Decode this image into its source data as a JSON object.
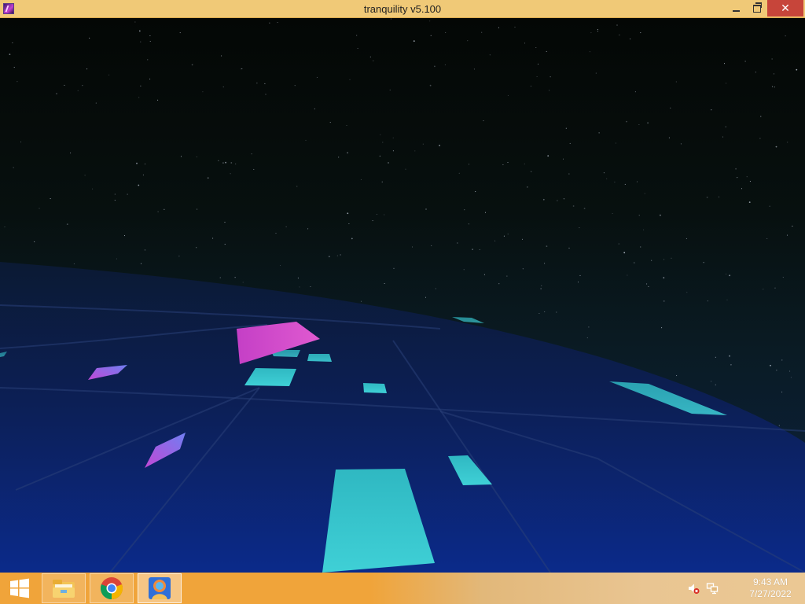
{
  "window": {
    "title": "tranquility v5.100",
    "close_glyph": "✕"
  },
  "icons": {
    "app": "tranquility-app-icon",
    "minimize": "minimize-icon",
    "restore": "restore-icon",
    "close": "close-icon",
    "start": "windows-logo-icon",
    "explorer": "file-explorer-icon",
    "chrome": "chrome-icon",
    "tranquility": "tranquility-icon",
    "volume": "volume-muted-icon",
    "network": "network-icon"
  },
  "scene": {
    "sky_colors": [
      "#050806",
      "#0a1a1c",
      "#0b1f3a"
    ],
    "floor_colors": [
      "#0a1d3f",
      "#0a2b80"
    ],
    "tile_cyan": "#39c6cf",
    "tile_magenta": "#d145c9",
    "tile_violet": "#8b5cf0"
  },
  "taskbar": {
    "apps": [
      {
        "name": "File Explorer"
      },
      {
        "name": "Google Chrome"
      },
      {
        "name": "tranquility v5.100",
        "active": true
      }
    ],
    "clock": {
      "time": "9:43 AM",
      "date": "7/27/2022"
    }
  }
}
